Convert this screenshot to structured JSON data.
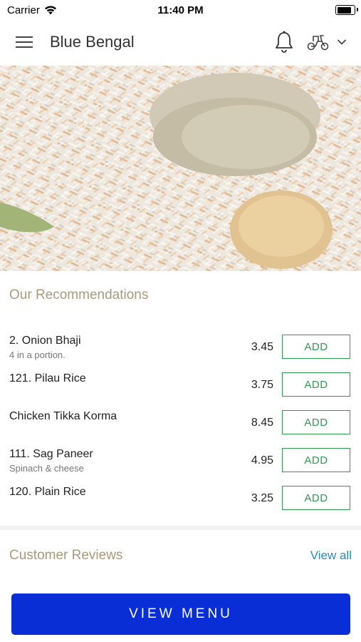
{
  "status": {
    "carrier": "Carrier",
    "time": "11:40 PM",
    "battery_level": 0.95
  },
  "header": {
    "title": "Blue Bengal"
  },
  "recommendations": {
    "title": "Our Recommendations",
    "add_label": "ADD",
    "items": [
      {
        "name": "2. Onion Bhaji",
        "description": "4 in a portion.",
        "price": "3.45"
      },
      {
        "name": "121. Pilau Rice",
        "description": "",
        "price": "3.75"
      },
      {
        "name": "Chicken Tikka Korma",
        "description": "",
        "price": "8.45"
      },
      {
        "name": "111. Sag Paneer",
        "description": "Spinach & cheese",
        "price": "4.95"
      },
      {
        "name": "120. Plain Rice",
        "description": "",
        "price": "3.25"
      }
    ]
  },
  "reviews": {
    "title": "Customer Reviews",
    "view_all": "View all"
  },
  "cta": {
    "label": "VIEW MENU"
  },
  "colors": {
    "accent_green": "#2e9a4e",
    "cta_blue": "#0a2ed6",
    "section_title": "#a99a7c",
    "link_blue": "#2a8ab8"
  },
  "icons": [
    "menu-icon",
    "bell-icon",
    "scooter-icon",
    "chevron-down-icon",
    "wifi-icon"
  ]
}
